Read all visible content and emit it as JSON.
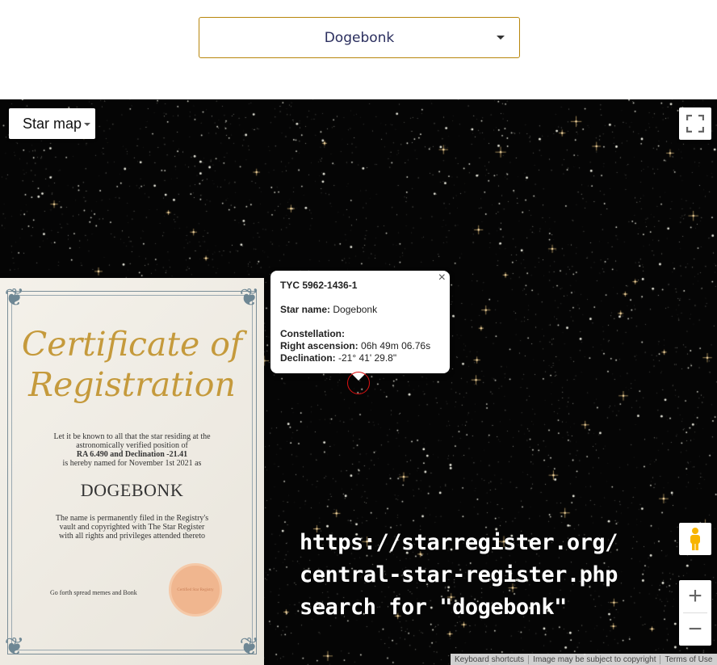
{
  "selector": {
    "value": "Dogebonk"
  },
  "map": {
    "type_control": "Star map",
    "credits": [
      "Keyboard shortcuts",
      "Image may be subject to copyright",
      "Terms of Use"
    ]
  },
  "infowindow": {
    "id": "TYC 5962-1436-1",
    "star_name_label": "Star name:",
    "star_name": "Dogebonk",
    "constellation_label": "Constellation:",
    "ra_label": "Right ascension:",
    "ra": "06h 49m 06.76s",
    "dec_label": "Declination:",
    "dec": "-21° 41' 29.8\"",
    "close": "×"
  },
  "certificate": {
    "title1": "Certificate of",
    "title2": "Registration",
    "body1": "Let it be known to all that the star residing at the",
    "body2": "astronomically verified position of",
    "body3": "RA 6.490 and Declination -21.41",
    "body4": "is hereby named for November 1st 2021 as",
    "name": "DOGEBONK",
    "body5": "The name is permanently filed in the Registry's",
    "body6": "vault and copyrighted with The Star Register",
    "body7": "with all rights and privileges attended thereto",
    "footer": "Go forth spread memes and Bonk",
    "seal": "Certified Star Registry"
  },
  "overlay_text": [
    "https://starregister.org/",
    "central-star-register.php",
    "search for \"dogebonk\""
  ],
  "icons": {
    "fullscreen": "fullscreen-icon",
    "pegman": "pegman-icon",
    "zoom_in": "+",
    "zoom_out": "−"
  }
}
